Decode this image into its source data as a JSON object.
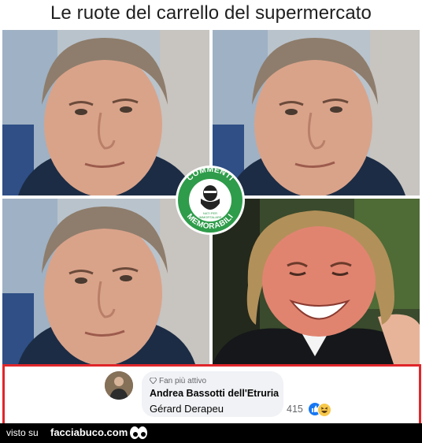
{
  "headline": "Le ruote del carrello del supermercato",
  "badge": {
    "top_text": "COMMENTI",
    "bottom_text": "MEMORABILI",
    "small_text": "NATI PER\nIMMORTALARE",
    "color": "#2e9c4a"
  },
  "comment": {
    "fan_label": "Fan più attivo",
    "author": "Andrea Bassotti dell'Etruria",
    "text": "Gérard Derapeu",
    "reaction_count": "415"
  },
  "footer": {
    "visto": "visto su",
    "site": "facciabuco.com"
  },
  "colors": {
    "frame": "#e0262b",
    "bubble": "#f0f2f5",
    "like": "#1877f2",
    "footer": "#000000"
  }
}
